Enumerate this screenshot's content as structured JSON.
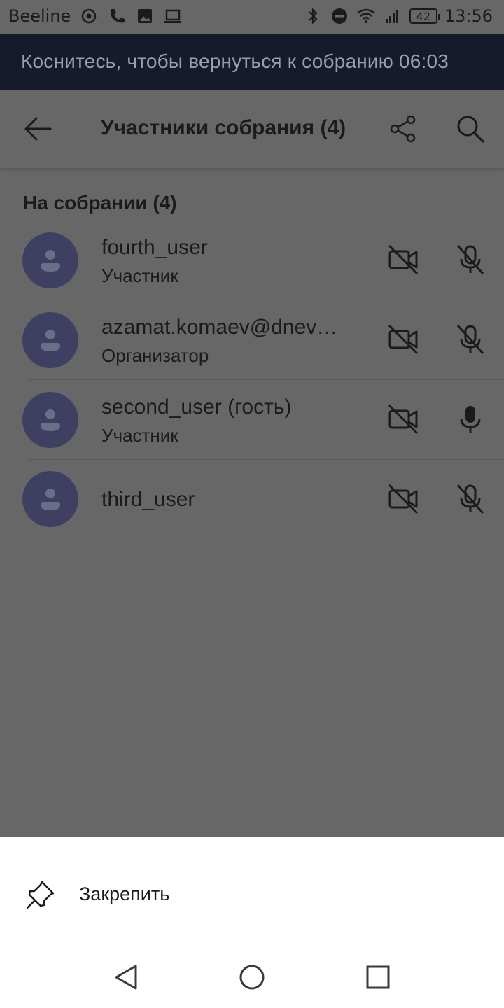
{
  "status_bar": {
    "carrier": "Beeline",
    "battery": "42",
    "time": "13:56"
  },
  "banner": {
    "text": "Коснитесь, чтобы вернуться к собранию 06:03"
  },
  "app_bar": {
    "title": "Участники собрания (4)"
  },
  "section": {
    "header": "На собрании (4)"
  },
  "participants": [
    {
      "name": "fourth_user",
      "role": "Участник",
      "camera": "off",
      "mic": "off"
    },
    {
      "name": "azamat.komaev@dnev…",
      "role": "Организатор",
      "camera": "off",
      "mic": "off"
    },
    {
      "name": "second_user (гость)",
      "role": "Участник",
      "camera": "off",
      "mic": "on"
    },
    {
      "name": "third_user",
      "role": "",
      "camera": "off",
      "mic": "off"
    }
  ],
  "sheet": {
    "pin_label": "Закрепить"
  },
  "icons": {
    "back": "arrow-left-icon",
    "share": "share-icon",
    "search": "search-icon",
    "camera_off": "video-off-icon",
    "mic_off": "mic-off-icon",
    "mic_on": "mic-icon",
    "pin": "pin-icon"
  },
  "colors": {
    "overlay": "#676767",
    "banner_bg": "#151b2a",
    "avatar": "#3f3f62",
    "sheet_bg": "#ffffff"
  }
}
